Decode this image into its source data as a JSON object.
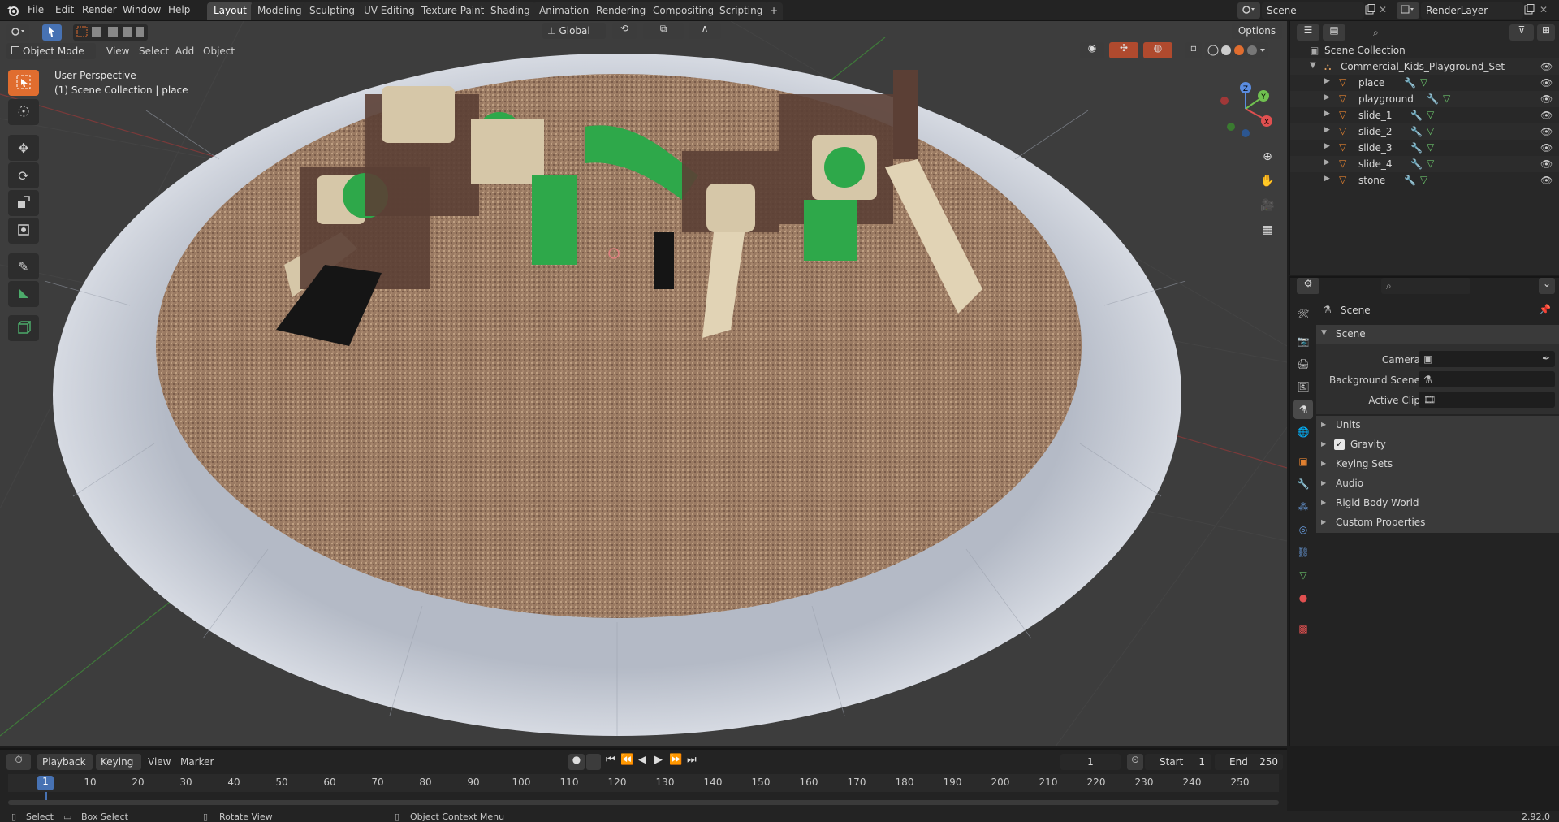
{
  "topbar": {
    "menus": [
      "File",
      "Edit",
      "Render",
      "Window",
      "Help"
    ],
    "workspace_tabs": [
      "Layout",
      "Modeling",
      "Sculpting",
      "UV Editing",
      "Texture Paint",
      "Shading",
      "Animation",
      "Rendering",
      "Compositing",
      "Scripting"
    ],
    "active_tab": "Layout",
    "add_tab": "+",
    "scene_name": "Scene",
    "render_layer": "RenderLayer"
  },
  "viewport_header": {
    "mode": "Object Mode",
    "menus": [
      "View",
      "Select",
      "Add",
      "Object"
    ],
    "transform_orientation": "Global",
    "options_label": "Options"
  },
  "viewport": {
    "perspective_label": "User Perspective",
    "collection_label": "(1) Scene Collection | place",
    "axes": {
      "x": "X",
      "y": "Y",
      "z": "Z"
    },
    "colors": {
      "ground": "#9a7a62",
      "rim": "#c9cdd6",
      "grid_bg": "#3d3d3d",
      "structure_green": "#2ea84a",
      "structure_brown": "#5b3f35",
      "structure_beige": "#d6c7a8"
    }
  },
  "outliner": {
    "root": "Scene Collection",
    "collection": "Commercial_Kids_Playground_Set",
    "objects": [
      "place",
      "playground",
      "slide_1",
      "slide_2",
      "slide_3",
      "slide_4",
      "stone"
    ]
  },
  "properties": {
    "header_title": "Scene",
    "panel_title": "Scene",
    "fields": [
      {
        "label": "Camera",
        "value": ""
      },
      {
        "label": "Background Scene",
        "value": ""
      },
      {
        "label": "Active Clip",
        "value": ""
      }
    ],
    "sections": [
      "Units",
      "Gravity",
      "Keying Sets",
      "Audio",
      "Rigid Body World",
      "Custom Properties"
    ],
    "gravity_checked": true
  },
  "timeline": {
    "menus": [
      "Playback",
      "Keying",
      "View",
      "Marker"
    ],
    "current_frame": "1",
    "start_label": "Start",
    "start_value": "1",
    "end_label": "End",
    "end_value": "250",
    "ruler": [
      "10",
      "20",
      "30",
      "40",
      "50",
      "60",
      "70",
      "80",
      "90",
      "100",
      "110",
      "120",
      "130",
      "140",
      "150",
      "160",
      "170",
      "180",
      "190",
      "200",
      "210",
      "220",
      "230",
      "240",
      "250"
    ],
    "playhead_label": "1"
  },
  "statusbar": {
    "items": [
      "Select",
      "Box Select",
      "Rotate View",
      "Object Context Menu"
    ],
    "version": "2.92.0"
  }
}
